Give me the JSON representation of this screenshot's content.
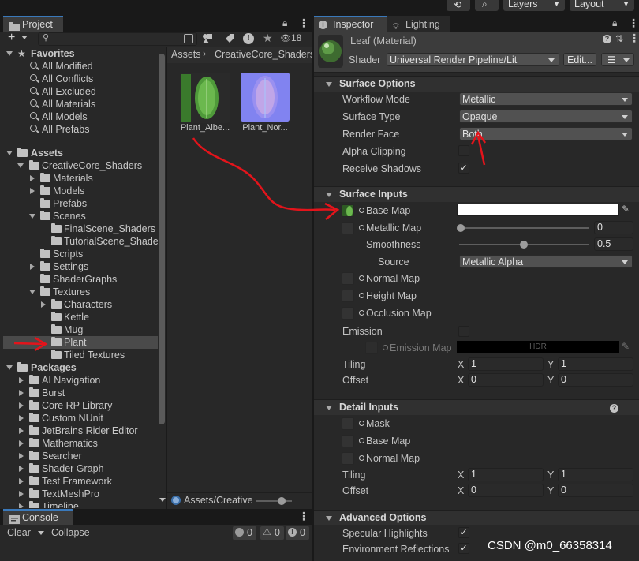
{
  "toolbar": {
    "layers_label": "Layers",
    "layout_label": "Layout"
  },
  "project_panel": {
    "tab_label": "Project",
    "hidden_count": "18",
    "breadcrumb": [
      "Assets",
      "CreativeCore_Shaders"
    ],
    "favorites_label": "Favorites",
    "favorites": [
      "All Modified",
      "All Conflicts",
      "All Excluded",
      "All Materials",
      "All Models",
      "All Prefabs"
    ],
    "assets_label": "Assets",
    "tree": {
      "creativecore": "CreativeCore_Shaders",
      "materials": "Materials",
      "models": "Models",
      "prefabs": "Prefabs",
      "scenes": "Scenes",
      "finalscene": "FinalScene_Shaders",
      "tutorialscene": "TutorialScene_Shade",
      "scripts": "Scripts",
      "settings": "Settings",
      "shadergraphs": "ShaderGraphs",
      "textures": "Textures",
      "characters": "Characters",
      "kettle": "Kettle",
      "mug": "Mug",
      "plant": "Plant",
      "tiled": "Tiled Textures"
    },
    "packages_label": "Packages",
    "packages": [
      "AI Navigation",
      "Burst",
      "Core RP Library",
      "Custom NUnit",
      "JetBrains Rider Editor",
      "Mathematics",
      "Searcher",
      "Shader Graph",
      "Test Framework",
      "TextMeshPro",
      "Timeline"
    ],
    "assets_grid": [
      {
        "name": "Plant_Albe..."
      },
      {
        "name": "Plant_Nor..."
      }
    ],
    "status_path": "Assets/Creative"
  },
  "console_panel": {
    "tab_label": "Console",
    "clear_label": "Clear",
    "collapse_label": "Collapse",
    "info_count": "0",
    "warning_count": "0",
    "error_count": "0"
  },
  "inspector": {
    "tab_label": "Inspector",
    "lighting_tab_label": "Lighting",
    "material_name": "Leaf (Material)",
    "shader_label": "Shader",
    "shader_value": "Universal Render Pipeline/Lit",
    "edit_label": "Edit...",
    "surface_options": {
      "title": "Surface Options",
      "workflow_mode_label": "Workflow Mode",
      "workflow_mode_value": "Metallic",
      "surface_type_label": "Surface Type",
      "surface_type_value": "Opaque",
      "render_face_label": "Render Face",
      "render_face_value": "Both",
      "alpha_clipping_label": "Alpha Clipping",
      "alpha_clipping_checked": false,
      "receive_shadows_label": "Receive Shadows",
      "receive_shadows_checked": true
    },
    "surface_inputs": {
      "title": "Surface Inputs",
      "base_map_label": "Base Map",
      "base_color": "#ffffff",
      "metallic_map_label": "Metallic Map",
      "metallic_value": "0",
      "smoothness_label": "Smoothness",
      "smoothness_value": "0.5",
      "source_label": "Source",
      "source_value": "Metallic Alpha",
      "normal_map_label": "Normal Map",
      "height_map_label": "Height Map",
      "occlusion_map_label": "Occlusion Map",
      "emission_label": "Emission",
      "emission_map_label": "Emission Map",
      "emission_hdr": "HDR",
      "tiling_label": "Tiling",
      "tiling_x": "1",
      "tiling_y": "1",
      "offset_label": "Offset",
      "offset_x": "0",
      "offset_y": "0"
    },
    "detail_inputs": {
      "title": "Detail Inputs",
      "mask_label": "Mask",
      "base_map_label": "Base Map",
      "normal_map_label": "Normal Map",
      "tiling_label": "Tiling",
      "tiling_x": "1",
      "tiling_y": "1",
      "offset_label": "Offset",
      "offset_x": "0",
      "offset_y": "0"
    },
    "advanced_options": {
      "title": "Advanced Options",
      "specular_label": "Specular Highlights",
      "specular_checked": true,
      "env_reflections_label": "Environment Reflections",
      "env_reflections_checked": true
    }
  },
  "axis_labels": {
    "x": "X",
    "y": "Y"
  },
  "watermark": "CSDN @m0_66358314"
}
